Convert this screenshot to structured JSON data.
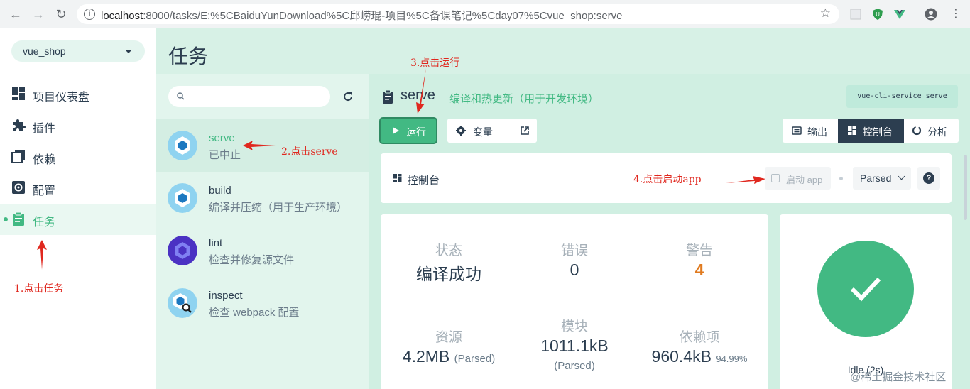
{
  "browser": {
    "url_host": "localhost",
    "url_rest": ":8000/tasks/E:%5CBaiduYunDownload%5C邱崂琨-项目%5C备课笔记%5Cday07%5Cvue_shop:serve"
  },
  "project": {
    "name": "vue_shop"
  },
  "sidebar": {
    "items": [
      {
        "label": "项目仪表盘",
        "icon": "dashboard-icon"
      },
      {
        "label": "插件",
        "icon": "puzzle-icon"
      },
      {
        "label": "依赖",
        "icon": "dependencies-icon"
      },
      {
        "label": "配置",
        "icon": "settings-icon"
      },
      {
        "label": "任务",
        "icon": "tasks-icon",
        "active": true
      }
    ]
  },
  "page": {
    "title": "任务"
  },
  "tasks": [
    {
      "name": "serve",
      "desc": "已中止",
      "active": true
    },
    {
      "name": "build",
      "desc": "编译并压缩（用于生产环境）"
    },
    {
      "name": "lint",
      "desc": "检查并修复源文件"
    },
    {
      "name": "inspect",
      "desc": "检查 webpack 配置"
    }
  ],
  "detail": {
    "title": "serve",
    "subtitle": "编译和热更新（用于开发环境）",
    "command": "vue-cli-service serve",
    "run_label": "运行",
    "vars_label": "变量",
    "output_label": "输出",
    "console_label": "控制台",
    "analyze_label": "分析"
  },
  "console": {
    "title": "控制台",
    "launch_label": "启动 app",
    "mode_selected": "Parsed"
  },
  "stats": {
    "status_label": "状态",
    "status_value": "编译成功",
    "errors_label": "错误",
    "errors_value": "0",
    "warnings_label": "警告",
    "warnings_value": "4",
    "assets_label": "资源",
    "assets_value": "4.2MB",
    "assets_note": "(Parsed)",
    "modules_label": "模块",
    "modules_value": "1011.1kB",
    "modules_note": "(Parsed)",
    "deps_label": "依赖项",
    "deps_value": "960.4kB",
    "deps_note": "94.99%"
  },
  "status": {
    "text": "Idle (2s)"
  },
  "annotations": {
    "a1": "1.点击任务",
    "a2": "2.点击serve",
    "a3": "3.点击运行",
    "a4": "4.点击启动app"
  },
  "watermark": "@稀土掘金技术社区",
  "colors": {
    "accent": "#42b983",
    "dark": "#2c3e50",
    "warning": "#e07a1f",
    "annotation": "#e0281f"
  }
}
